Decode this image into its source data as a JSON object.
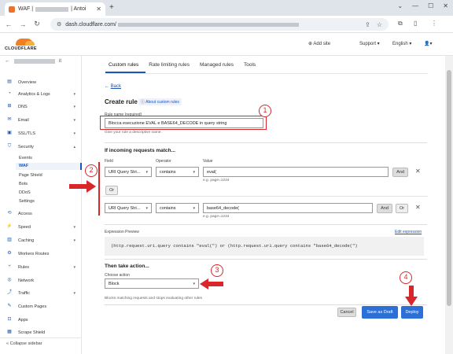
{
  "browser": {
    "tab_title_prefix": "WAF |",
    "tab_title_suffix": "| Antoi",
    "url_prefix": "dash.cloudflare.com/"
  },
  "header": {
    "logo_text": "CLOUDFLARE",
    "add_site": "Add site",
    "support": "Support",
    "language": "English"
  },
  "sidebar": {
    "items": [
      {
        "label": "Overview",
        "icon": "document-icon"
      },
      {
        "label": "Analytics & Logs",
        "icon": "chart-icon",
        "chev": "▾"
      },
      {
        "label": "DNS",
        "icon": "dns-icon",
        "chev": "▾"
      },
      {
        "label": "Email",
        "icon": "email-icon",
        "chev": "▾"
      },
      {
        "label": "SSL/TLS",
        "icon": "lock-icon",
        "chev": "▾"
      },
      {
        "label": "Security",
        "icon": "shield-icon",
        "chev": "▴"
      }
    ],
    "security_sub": [
      "Events",
      "WAF",
      "Page Shield",
      "Bots",
      "DDoS",
      "Settings"
    ],
    "items2": [
      {
        "label": "Access",
        "icon": "access-icon"
      },
      {
        "label": "Speed",
        "icon": "speed-icon",
        "chev": "▾"
      },
      {
        "label": "Caching",
        "icon": "caching-icon",
        "chev": "▾"
      },
      {
        "label": "Workers Routes",
        "icon": "workers-icon"
      },
      {
        "label": "Rules",
        "icon": "rules-icon",
        "chev": "▾"
      },
      {
        "label": "Network",
        "icon": "network-icon"
      },
      {
        "label": "Traffic",
        "icon": "traffic-icon",
        "chev": "▾"
      },
      {
        "label": "Custom Pages",
        "icon": "custom-pages-icon"
      },
      {
        "label": "Apps",
        "icon": "apps-icon"
      },
      {
        "label": "Scrape Shield",
        "icon": "scrape-shield-icon"
      }
    ],
    "collapse": "Collapse sidebar"
  },
  "tabs": [
    "Custom rules",
    "Rate limiting rules",
    "Managed rules",
    "Tools"
  ],
  "form": {
    "back": "Back",
    "title": "Create rule",
    "about": "About custom rules",
    "rule_name_label": "Rule name (required)",
    "rule_name_value": "Blocca esecuzione EVAL e BASE64_DECODE in query string",
    "rule_name_hint": "Give your rule a descriptive name.",
    "if_heading": "If incoming requests match...",
    "field_label": "Field",
    "operator_label": "Operator",
    "value_label": "Value",
    "rows": [
      {
        "field": "URI Query Stri...",
        "operator": "contains",
        "value": "eval(",
        "hint": "e.g. page=1234"
      },
      {
        "field": "URI Query Stri...",
        "operator": "contains",
        "value": "base64_decode(",
        "hint": "e.g. page=1234"
      }
    ],
    "and_label": "And",
    "or_label": "Or",
    "expr_label": "Expression Preview",
    "edit_expr": "Edit expression",
    "expression": "(http.request.uri.query contains \"eval(\") or (http.request.uri.query contains \"base64_decode(\")",
    "then_heading": "Then take action...",
    "choose_action": "Choose action",
    "action_value": "Block",
    "action_hint": "Blocks matching requests and stops evaluating other rules",
    "cancel": "Cancel",
    "save_draft": "Save as Draft",
    "deploy": "Deploy"
  },
  "annotations": [
    "1",
    "2",
    "3",
    "4"
  ],
  "colors": {
    "accent": "#1a56b8",
    "annotation": "#d9262b",
    "brand": "#f38020"
  }
}
